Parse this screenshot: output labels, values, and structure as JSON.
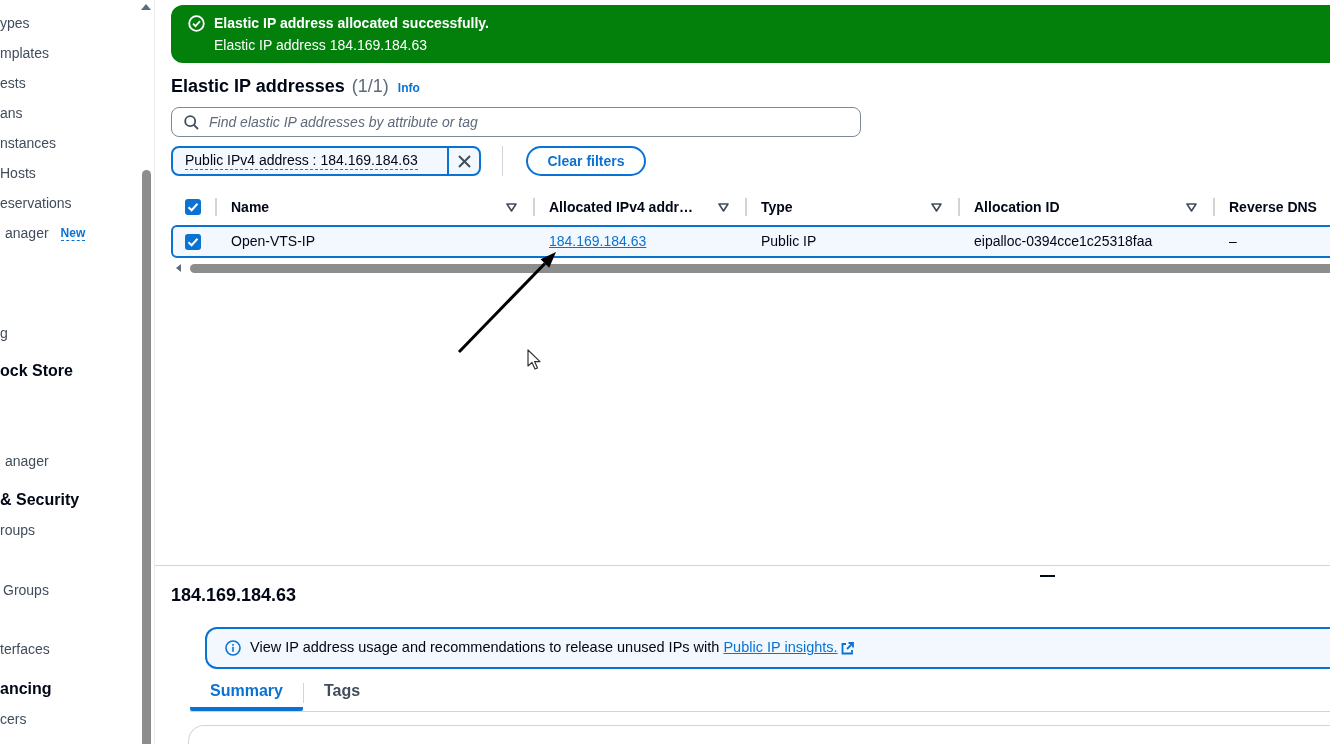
{
  "sidebar": {
    "items": [
      {
        "kind": "link",
        "label": "ypes"
      },
      {
        "kind": "link",
        "label": "mplates"
      },
      {
        "kind": "link",
        "label": "ests"
      },
      {
        "kind": "link",
        "label": "ans"
      },
      {
        "kind": "link",
        "label": "nstances"
      },
      {
        "kind": "link",
        "label": "Hosts"
      },
      {
        "kind": "link",
        "label": "eservations"
      },
      {
        "kind": "link",
        "label": "anager",
        "badge": "New"
      },
      {
        "kind": "link",
        "label": "g"
      },
      {
        "kind": "heading",
        "label": "ock Store"
      },
      {
        "kind": "link",
        "label": "anager"
      },
      {
        "kind": "heading",
        "label": "& Security"
      },
      {
        "kind": "link",
        "label": "roups"
      },
      {
        "kind": "link",
        "label": "Groups"
      },
      {
        "kind": "link",
        "label": "terfaces"
      },
      {
        "kind": "heading",
        "label": "ancing"
      },
      {
        "kind": "link",
        "label": "cers"
      }
    ]
  },
  "flash": {
    "title": "Elastic IP address allocated successfully.",
    "message": "Elastic IP address 184.169.184.63"
  },
  "header": {
    "title": "Elastic IP addresses",
    "count": "(1/1)",
    "info": "Info"
  },
  "search": {
    "placeholder": "Find elastic IP addresses by attribute or tag"
  },
  "filter_tokens": [
    {
      "label": "Public IPv4 address : 184.169.184.63"
    }
  ],
  "clear_filters": "Clear filters",
  "table": {
    "select_all": {
      "checked": true
    },
    "columns": [
      {
        "label": "Name"
      },
      {
        "label": "Allocated IPv4 addr…"
      },
      {
        "label": "Type"
      },
      {
        "label": "Allocation ID"
      },
      {
        "label": "Reverse DNS"
      }
    ],
    "rows": [
      {
        "selected": true,
        "cells": [
          {
            "kind": "text",
            "text": "Open-VTS-IP"
          },
          {
            "kind": "link",
            "text": "184.169.184.63"
          },
          {
            "kind": "text",
            "text": "Public IP"
          },
          {
            "kind": "text",
            "text": "eipalloc-0394cce1c25318faa"
          },
          {
            "kind": "text",
            "text": "–"
          }
        ]
      }
    ]
  },
  "details": {
    "title": "184.169.184.63",
    "alert": {
      "text": "View IP address usage and recommendations to release unused IPs with",
      "link": "Public IP insights."
    },
    "tabs": [
      {
        "label": "Summary",
        "selected": true
      },
      {
        "label": "Tags",
        "selected": false
      }
    ]
  }
}
